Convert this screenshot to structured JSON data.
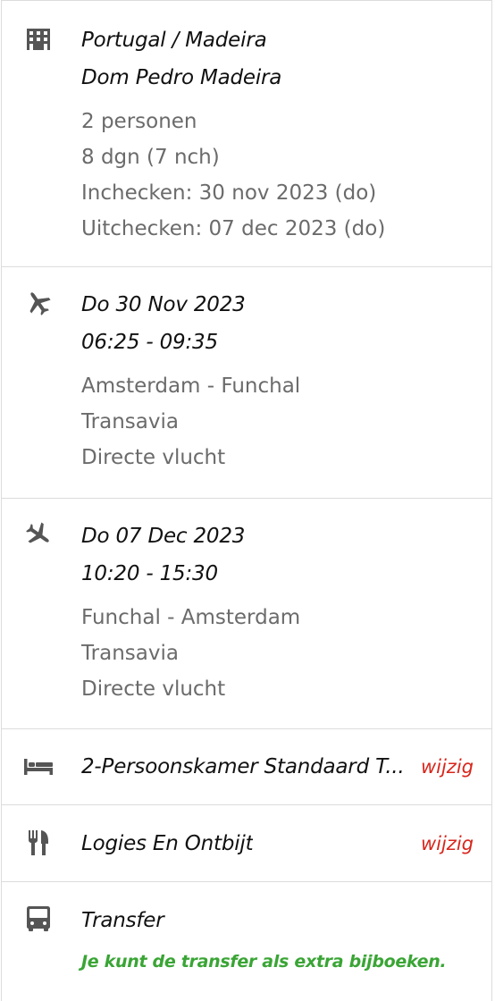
{
  "hotel": {
    "icon": "building-icon",
    "location": "Portugal / Madeira",
    "name": "Dom Pedro Madeira",
    "persons": "2 personen",
    "duration": "8 dgn (7 nch)",
    "checkin": "Inchecken: 30 nov 2023 (do)",
    "checkout": "Uitchecken: 07 dec 2023 (do)"
  },
  "outbound": {
    "icon": "airplane-departure-icon",
    "date": "Do 30 Nov 2023",
    "time": "06:25 - 09:35",
    "route": "Amsterdam - Funchal",
    "airline": "Transavia",
    "type": "Directe vlucht"
  },
  "return": {
    "icon": "airplane-arrival-icon",
    "date": "Do 07 Dec 2023",
    "time": "10:20 - 15:30",
    "route": "Funchal - Amsterdam",
    "airline": "Transavia",
    "type": "Directe vlucht"
  },
  "room": {
    "icon": "bed-icon",
    "label": "2-Persoonskamer Standaard T...",
    "action": "wijzig"
  },
  "board": {
    "icon": "cutlery-icon",
    "label": "Logies En Ontbijt",
    "action": "wijzig"
  },
  "transfer": {
    "icon": "bus-icon",
    "label": "Transfer",
    "note": "Je kunt de transfer als extra bijboeken."
  },
  "colors": {
    "icon": "#555555",
    "muted_text": "#6b6b6b",
    "link": "#d8261c",
    "promo": "#3aa535",
    "border": "#dcdcdc"
  }
}
